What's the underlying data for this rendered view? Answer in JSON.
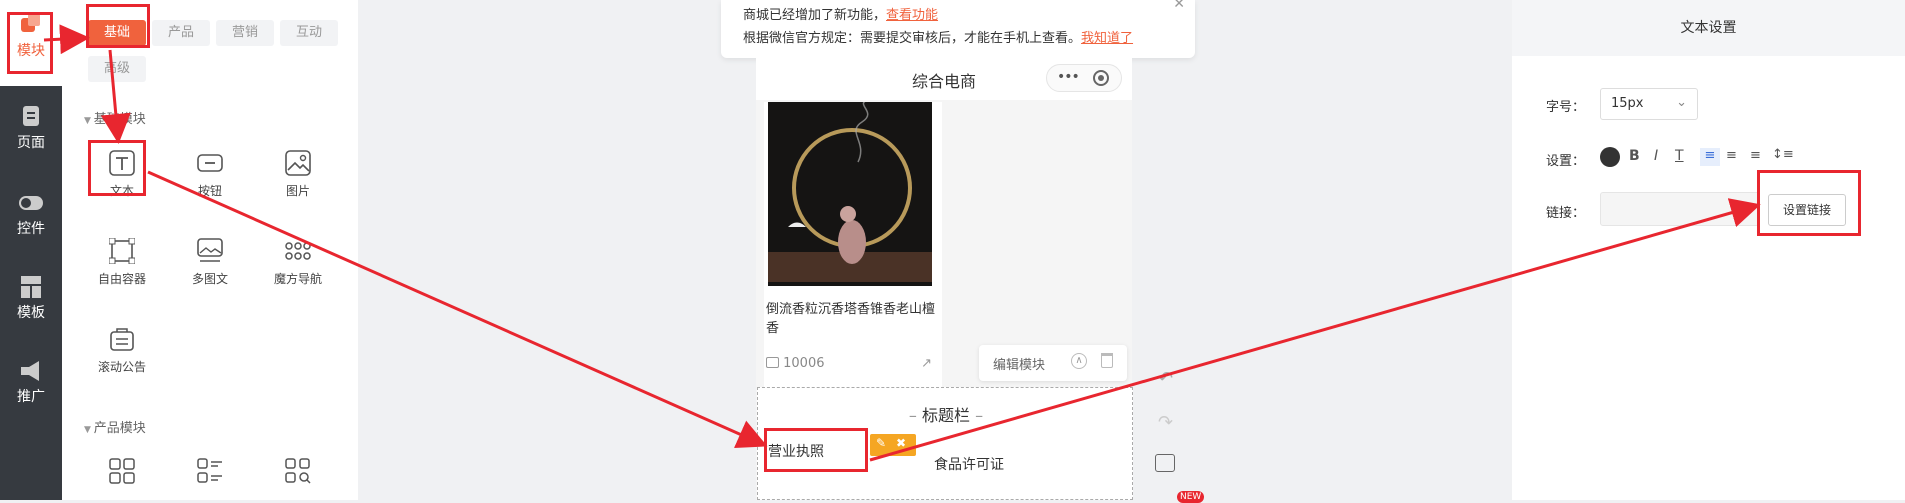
{
  "nav": {
    "items": [
      {
        "label": "模块",
        "icon": "module-icon"
      },
      {
        "label": "页面",
        "icon": "page-icon"
      },
      {
        "label": "控件",
        "icon": "toggle-icon"
      },
      {
        "label": "模板",
        "icon": "template-icon"
      },
      {
        "label": "推广",
        "icon": "megaphone-icon"
      }
    ]
  },
  "panel": {
    "tabs": [
      "基础",
      "产品",
      "营销",
      "互动",
      "高级"
    ],
    "section_basic": "基础模块",
    "modules": [
      {
        "label": "文本",
        "icon": "text-icon"
      },
      {
        "label": "按钮",
        "icon": "button-icon"
      },
      {
        "label": "图片",
        "icon": "image-icon"
      },
      {
        "label": "自由容器",
        "icon": "container-icon"
      },
      {
        "label": "多图文",
        "icon": "multi-image-icon"
      },
      {
        "label": "魔方导航",
        "icon": "grid-nav-icon"
      },
      {
        "label": "滚动公告",
        "icon": "notice-icon"
      }
    ],
    "section_product": "产品模块"
  },
  "notice": {
    "line1": "商城已经增加了新功能，",
    "link1": "查看功能",
    "line2": "根据微信官方规定：需要提交审核后，才能在手机上查看。",
    "link2": "我知道了"
  },
  "phone": {
    "title": "综合电商",
    "product_name": "倒流香粒沉香塔香锥香老山檀香",
    "views": "10006"
  },
  "toolbar": {
    "edit_label": "编辑模块"
  },
  "block": {
    "title": "标题栏",
    "item1": "营业执照",
    "item2": "食品许可证"
  },
  "badge_new": "NEW",
  "right": {
    "header": "文本设置",
    "font_size_label": "字号：",
    "font_size_value": "15px",
    "settings_label": "设置：",
    "link_label": "链接：",
    "set_link_button": "设置链接"
  },
  "colors": {
    "accent": "#f0623d",
    "annotation": "#e8262f",
    "nav_bg": "#363a40"
  }
}
